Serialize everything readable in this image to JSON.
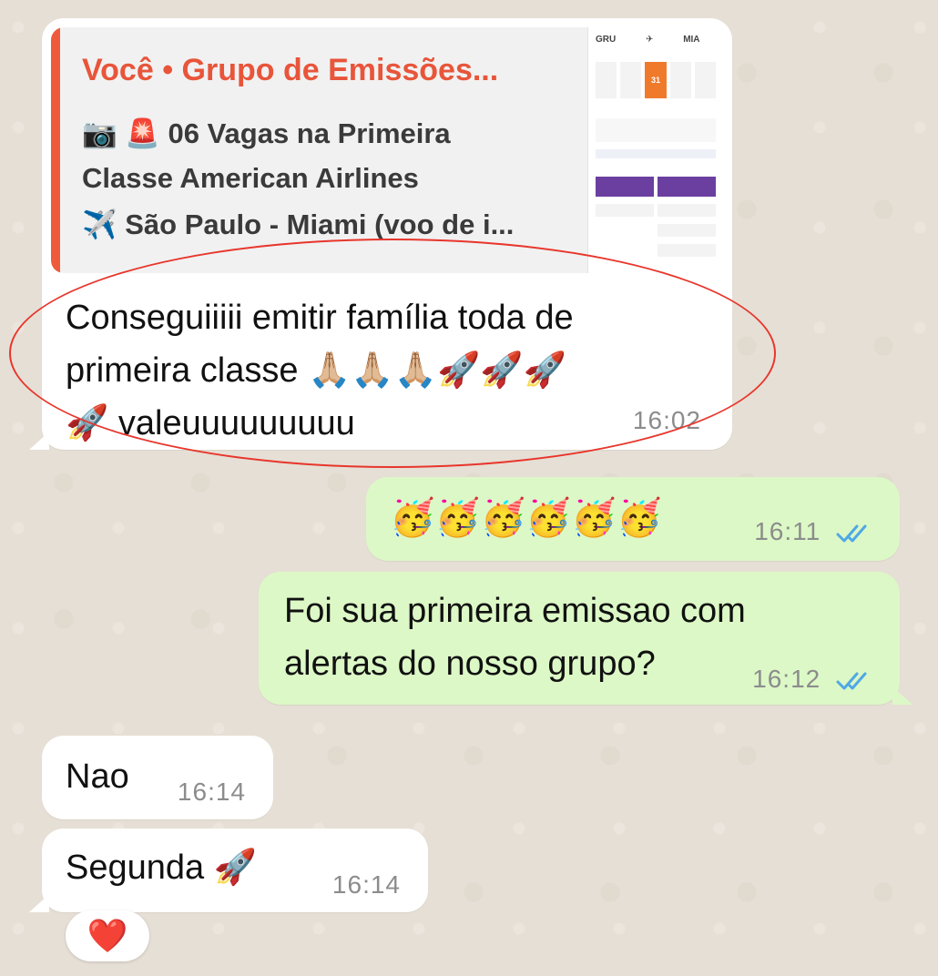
{
  "messages": {
    "quoted": {
      "title": "Você • Grupo de Emissões...",
      "camera_icon": "📷",
      "siren_icon": "🚨",
      "line1": "06 Vagas na Primeira",
      "line2": "Classe American Airlines",
      "plane_icon": "✈️",
      "line3": "São Paulo - Miami (voo de i...",
      "thumbnail": {
        "origin": "GRU",
        "destination": "MIA",
        "day": "31"
      }
    },
    "msg1": {
      "line1": "Conseguiiiii emitir família toda de",
      "line2": "primeira classe 🙏🏼🙏🏼🙏🏼🚀🚀🚀",
      "line3": "🚀 valeuuuuuuuuu",
      "time": "16:02"
    },
    "msg2": {
      "text": "🥳🥳🥳🥳🥳🥳",
      "time": "16:11"
    },
    "msg3": {
      "line1": "Foi sua primeira emissao com",
      "line2": "alertas do nosso grupo?",
      "time": "16:12"
    },
    "msg4": {
      "text": "Nao",
      "time": "16:14"
    },
    "msg5": {
      "text": "Segunda 🚀",
      "time": "16:14",
      "reaction": "❤️"
    }
  },
  "colors": {
    "incoming": "#ffffff",
    "outgoing": "#dcf8c6",
    "quote_accent": "#ef5a3c",
    "read_ticks": "#4fa8e6",
    "annotation_oval": "#e8362c"
  },
  "icons": {
    "read_receipt": "double-check-icon"
  }
}
